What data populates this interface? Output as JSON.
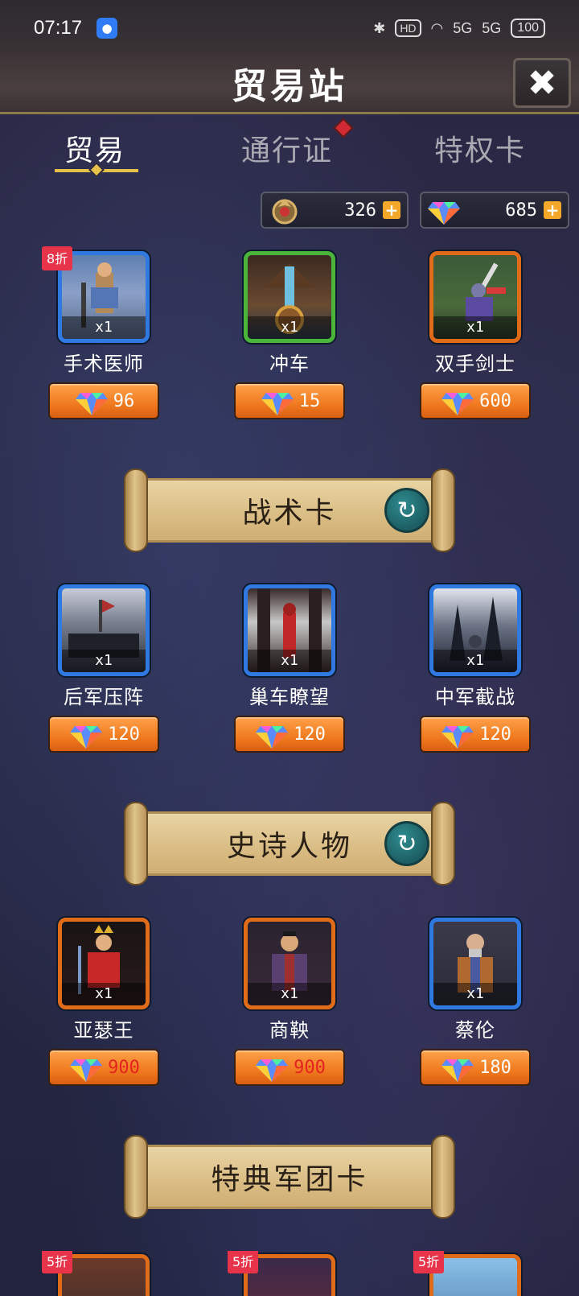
{
  "status": {
    "time": "07:17",
    "hd": "HD",
    "signal1": "5G",
    "signal2": "5G",
    "battery": "100"
  },
  "header": {
    "title": "贸易站",
    "close": "✖"
  },
  "tabs": [
    {
      "label": "贸易",
      "active": true
    },
    {
      "label": "通行证",
      "badge": true
    },
    {
      "label": "特权卡"
    }
  ],
  "currency": {
    "honor": "326",
    "gems": "685",
    "plus": "+"
  },
  "qty": "x1",
  "row1": [
    {
      "name": "手术医师",
      "price": "96",
      "discount": "8折",
      "frame": "blue"
    },
    {
      "name": "冲车",
      "price": "15",
      "frame": "green"
    },
    {
      "name": "双手剑士",
      "price": "600",
      "frame": "orange"
    }
  ],
  "banner1": {
    "title": "战术卡",
    "refresh": "↻"
  },
  "row2": [
    {
      "name": "后军压阵",
      "price": "120",
      "frame": "blue"
    },
    {
      "name": "巢车瞭望",
      "price": "120",
      "frame": "blue"
    },
    {
      "name": "中军截战",
      "price": "120",
      "frame": "blue"
    }
  ],
  "banner2": {
    "title": "史诗人物",
    "refresh": "↻"
  },
  "row3": [
    {
      "name": "亚瑟王",
      "price": "900",
      "frame": "orange",
      "red": true
    },
    {
      "name": "商鞅",
      "price": "900",
      "frame": "orange",
      "red": true
    },
    {
      "name": "蔡伦",
      "price": "180",
      "frame": "blue"
    }
  ],
  "banner3": {
    "title": "特典军团卡"
  },
  "row4": [
    {
      "discount": "5折",
      "frame": "orange"
    },
    {
      "discount": "5折",
      "frame": "orange"
    },
    {
      "discount": "5折",
      "frame": "orange"
    }
  ]
}
